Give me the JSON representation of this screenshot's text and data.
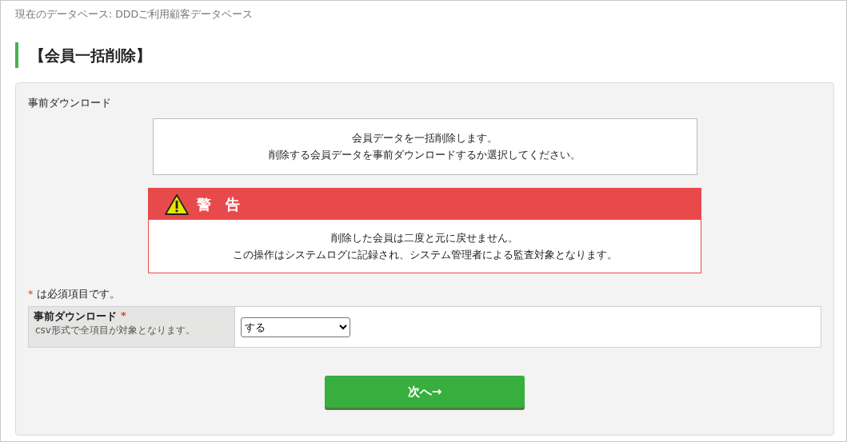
{
  "current_database": "現在のデータベース: DDDご利用顧客データベース",
  "page_title": "【会員一括削除】",
  "panel": {
    "title": "事前ダウンロード",
    "info_lines": [
      "会員データを一括削除します。",
      "削除する会員データを事前ダウンロードするか選択してください。"
    ],
    "warning": {
      "title": "警　告",
      "lines": [
        "削除した会員は二度と元に戻せません。",
        "この操作はシステムログに記録され、システム管理者による監査対象となります。"
      ]
    },
    "required_note": {
      "mark": "*",
      "text": "は必須項目です。"
    },
    "form_rows": [
      {
        "label": "事前ダウンロード",
        "required_mark": "*",
        "hint": "csv形式で全項目が対象となります。",
        "value": "する"
      }
    ],
    "submit_button": "次へ→"
  }
}
